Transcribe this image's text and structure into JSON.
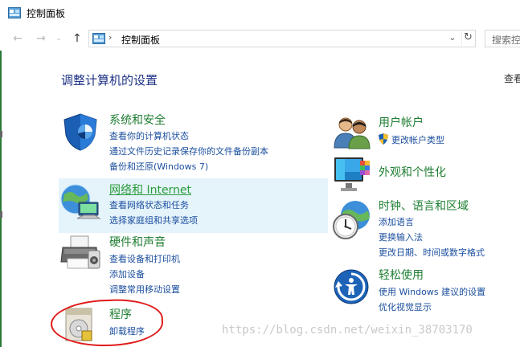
{
  "window": {
    "title": "控制面板"
  },
  "navigation": {
    "back_icon": "back-arrow-icon",
    "forward_icon": "forward-arrow-icon",
    "up_icon": "up-arrow-icon",
    "address_separator": "›",
    "address_path": "控制面板",
    "dropdown_glyph": "⌄",
    "refresh_glyph": "↻",
    "search_placeholder": "搜索控"
  },
  "main": {
    "heading": "调整计算机的设置",
    "view_by_label": "查看",
    "left_categories": [
      {
        "title": "系统和安全",
        "icon": "shield-icon",
        "links": [
          "查看你的计算机状态",
          "通过文件历史记录保存你的文件备份副本",
          "备份和还原(Windows 7)"
        ]
      },
      {
        "title": "网络和 Internet",
        "icon": "network-globe-icon",
        "links": [
          "查看网络状态和任务",
          "选择家庭组和共享选项"
        ],
        "highlighted": true
      },
      {
        "title": "硬件和声音",
        "icon": "printer-icon",
        "links": [
          "查看设备和打印机",
          "添加设备",
          "调整常用移动设置"
        ]
      },
      {
        "title": "程序",
        "icon": "programs-disc-icon",
        "links": [
          "卸载程序"
        ]
      }
    ],
    "right_categories": [
      {
        "title": "用户帐户",
        "icon": "users-icon",
        "links": [
          "更改帐户类型"
        ],
        "link_icon": "uac-shield-icon"
      },
      {
        "title": "外观和个性化",
        "icon": "monitor-icon",
        "links": []
      },
      {
        "title": "时钟、语言和区域",
        "icon": "clock-globe-icon",
        "links": [
          "添加语言",
          "更换输入法",
          "更改日期、时间或数字格式"
        ]
      },
      {
        "title": "轻松使用",
        "icon": "ease-of-access-icon",
        "links": [
          "使用 Windows 建议的设置",
          "优化视觉显示"
        ]
      }
    ]
  },
  "watermark": "https://blog.csdn.net/weixin_38703170",
  "colors": {
    "heading": "#1e3287",
    "category_title": "#1e7e32",
    "link": "#1a4e9e",
    "highlight_bg": "#e5f3fb",
    "annotation_red": "#e01b1b"
  }
}
